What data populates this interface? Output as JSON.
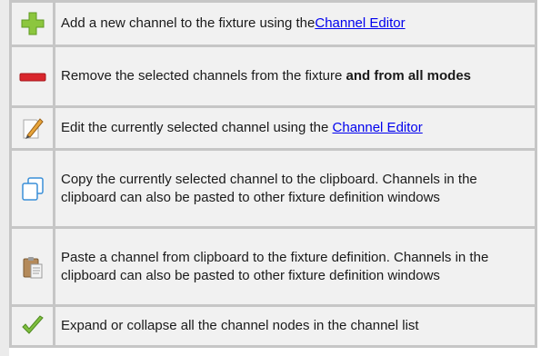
{
  "rows": [
    {
      "icon": "add-channel-icon",
      "text_before": "Add a new channel to the fixture using the",
      "link": "Channel Editor"
    },
    {
      "icon": "remove-channel-icon",
      "text_before": "Remove the selected channels from the fixture ",
      "bold": "and from all modes"
    },
    {
      "icon": "edit-channel-icon",
      "text_before": "Edit the currently selected channel using the ",
      "link": "Channel Editor"
    },
    {
      "icon": "copy-channel-icon",
      "text_before": "Copy the currently selected channel to the clipboard. Channels in the clipboard can also be pasted to other fixture definition windows"
    },
    {
      "icon": "paste-channel-icon",
      "text_before": "Paste a channel from clipboard to the fixture definition. Channels in the clipboard can also be pasted to other fixture definition windows"
    },
    {
      "icon": "expand-collapse-icon",
      "text_before": "Expand or collapse all the channel nodes in the channel list"
    }
  ],
  "colors": {
    "add_green": "#8cc63e",
    "remove_red": "#d9262c",
    "link_blue": "#0000ee",
    "copy_blue": "#3a8fd8",
    "check_green": "#7fbf3f"
  }
}
